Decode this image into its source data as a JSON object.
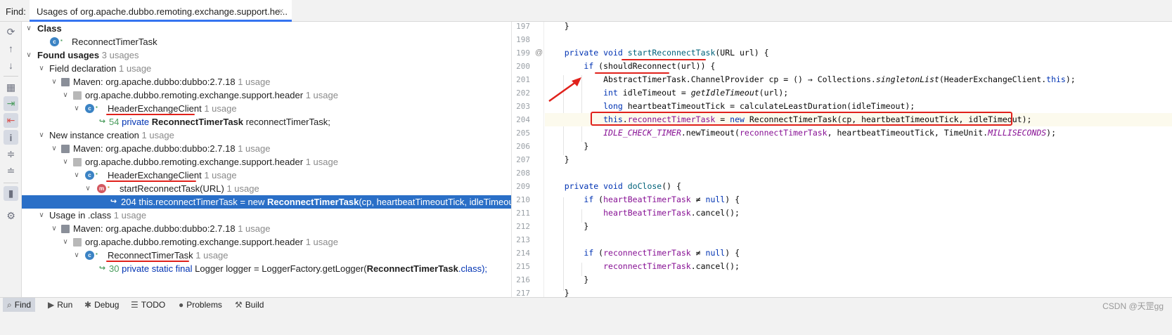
{
  "topbar": {
    "find_label": "Find:",
    "tab_title": "Usages of org.apache.dubbo.remoting.exchange.support.he...",
    "tab_close": "×"
  },
  "toolbar_icons": [
    "rerun-icon",
    "up-arrow-icon",
    "down-arrow-icon",
    "group-icon",
    "navigate-icon",
    "exclude-icon",
    "info-icon",
    "expand-all-icon",
    "collapse-all-icon",
    "preview-icon",
    "settings-icon"
  ],
  "tree": {
    "class_header": "Class",
    "class_item": "ReconnectTimerTask",
    "found_usages": "Found usages",
    "found_usages_count": "3 usages",
    "groups": [
      {
        "label": "Field declaration",
        "count": "1 usage",
        "maven": "Maven: org.apache.dubbo:dubbo:2.7.18",
        "maven_count": "1 usage",
        "package": "org.apache.dubbo.remoting.exchange.support.header",
        "package_count": "1 usage",
        "class": "HeaderExchangeClient",
        "class_count": "1 usage",
        "usage_line": "54",
        "usage_kw": "private",
        "usage_bold": "ReconnectTimerTask",
        "usage_rest": "reconnectTimerTask;"
      },
      {
        "label": "New instance creation",
        "count": "1 usage",
        "maven": "Maven: org.apache.dubbo:dubbo:2.7.18",
        "maven_count": "1 usage",
        "package": "org.apache.dubbo.remoting.exchange.support.header",
        "package_count": "1 usage",
        "class": "HeaderExchangeClient",
        "class_count": "1 usage",
        "method": "startReconnectTask(URL)",
        "method_count": "1 usage",
        "usage_line": "204",
        "usage_pre": "this.reconnectTimerTask = new",
        "usage_bold": "ReconnectTimerTask",
        "usage_rest": "(cp, heartbeatTimeoutTick, idleTimeout);"
      },
      {
        "label": "Usage in .class",
        "count": "1 usage",
        "maven": "Maven: org.apache.dubbo:dubbo:2.7.18",
        "maven_count": "1 usage",
        "package": "org.apache.dubbo.remoting.exchange.support.header",
        "package_count": "1 usage",
        "class": "ReconnectTimerTask",
        "class_count": "1 usage",
        "usage_line": "30",
        "usage_kw": "private static final",
        "usage_mid": "Logger logger = LoggerFactory.getLogger(",
        "usage_bold": "ReconnectTimerTask",
        "usage_rest": ".class);"
      }
    ]
  },
  "editor": {
    "line_numbers": [
      "197",
      "198",
      "199",
      "200",
      "201",
      "202",
      "203",
      "204",
      "205",
      "206",
      "207",
      "208",
      "209",
      "210",
      "211",
      "212",
      "213",
      "214",
      "215",
      "216",
      "217"
    ],
    "override_marker": "@",
    "lines": [
      "    }",
      "",
      "    private void startReconnectTask(URL url) {",
      "        if (shouldReconnect(url)) {",
      "            AbstractTimerTask.ChannelProvider cp = () → Collections.singletonList(HeaderExchangeClient.this);",
      "            int idleTimeout = getIdleTimeout(url);",
      "            long heartbeatTimeoutTick = calculateLeastDuration(idleTimeout);",
      "            this.reconnectTimerTask = new ReconnectTimerTask(cp, heartbeatTimeoutTick, idleTimeout);",
      "            IDLE_CHECK_TIMER.newTimeout(reconnectTimerTask, heartbeatTimeoutTick, TimeUnit.MILLISECONDS);",
      "        }",
      "    }",
      "",
      "    private void doClose() {",
      "        if (heartBeatTimerTask ≠ null) {",
      "            heartBeatTimerTask.cancel();",
      "        }",
      "",
      "        if (reconnectTimerTask ≠ null) {",
      "            reconnectTimerTask.cancel();",
      "        }",
      "    }"
    ]
  },
  "bottombar": {
    "find": "Find",
    "run": "Run",
    "debug": "Debug",
    "todo": "TODO",
    "problems": "Problems",
    "build": "Build",
    "watermark": "CSDN @天罡gg"
  },
  "colors": {
    "accent": "#3574f0",
    "selection": "#2a6fc7",
    "annotation_red": "#e0211b",
    "keyword": "#0033b3",
    "field": "#871094"
  }
}
